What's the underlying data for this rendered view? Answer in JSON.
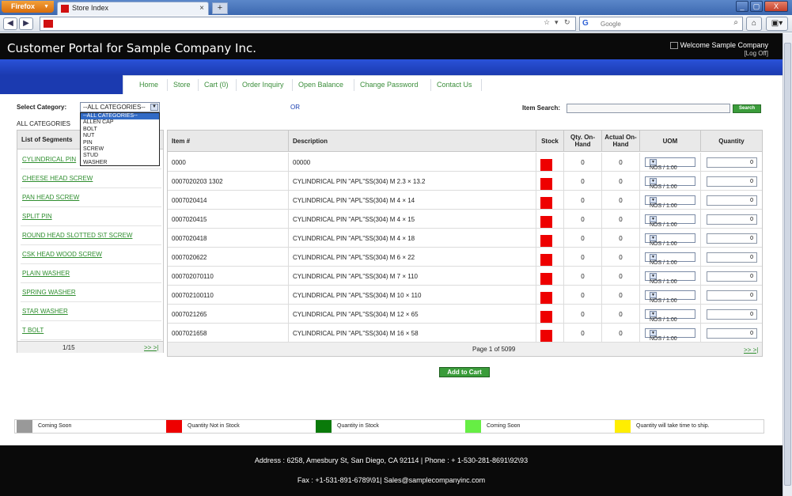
{
  "browser": {
    "menu_button": "Firefox",
    "tab_title": "Store Index",
    "search_placeholder": "Google",
    "new_tab": "+",
    "tab_close": "×",
    "minimize": "_",
    "maximize": "▢",
    "close": "X"
  },
  "header": {
    "title": "Customer Portal  for Sample Company Inc.",
    "welcome_label": "Welcome",
    "company": "Sample Company",
    "logoff": "[Log Off]"
  },
  "menu": [
    "Home",
    "Store",
    "Cart (0)",
    "Order Inquiry",
    "Open Balance",
    "Change Password",
    "Contact Us"
  ],
  "filters": {
    "select_category_label": "Select Category:",
    "selected_category": "--ALL CATEGORIES--",
    "or_text": "OR",
    "item_search_label": "Item Search:",
    "search_button": "Search",
    "all_categories_text": "ALL CATEGORIES"
  },
  "category_options": [
    "--ALL CATEGORIES--",
    "ALLEN CAP",
    "BOLT",
    "NUT",
    "PIN",
    "SCREW",
    "STUD",
    "WASHER"
  ],
  "segments": {
    "header": "List of Segments",
    "items": [
      "CYLINDRICAL PIN",
      "CHEESE HEAD SCREW",
      "PAN HEAD SCREW",
      "SPLIT PIN",
      "ROUND HEAD SLOTTED S\\T SCREW",
      "CSK HEAD WOOD SCREW",
      "PLAIN WASHER",
      "SPRING WASHER",
      "STAR WASHER",
      "T BOLT"
    ],
    "page": "1/15",
    "nav": ">> >|"
  },
  "table": {
    "columns": [
      "Item #",
      "Description",
      "Stock",
      "Qty. On-Hand",
      "Actual On-Hand",
      "UOM",
      "Quantity"
    ],
    "rows": [
      {
        "item": "0000",
        "desc": "00000",
        "stock_color": "#ee0000",
        "qty": "0",
        "actual": "0",
        "uom": "NOS / 1.00",
        "quantity": "0"
      },
      {
        "item": "0007020203 1302",
        "desc": "CYLINDRICAL PIN \"APL\"SS(304) M 2.3 × 13.2",
        "stock_color": "#ee0000",
        "qty": "0",
        "actual": "0",
        "uom": "NOS / 1.00",
        "quantity": "0"
      },
      {
        "item": "0007020414",
        "desc": "CYLINDRICAL PIN \"APL\"SS(304) M 4 × 14",
        "stock_color": "#ee0000",
        "qty": "0",
        "actual": "0",
        "uom": "NOS / 1.00",
        "quantity": "0"
      },
      {
        "item": "0007020415",
        "desc": "CYLINDRICAL PIN \"APL\"SS(304) M 4 × 15",
        "stock_color": "#ee0000",
        "qty": "0",
        "actual": "0",
        "uom": "NOS / 1.00",
        "quantity": "0"
      },
      {
        "item": "0007020418",
        "desc": "CYLINDRICAL PIN \"APL\"SS(304) M 4 × 18",
        "stock_color": "#ee0000",
        "qty": "0",
        "actual": "0",
        "uom": "NOS / 1.00",
        "quantity": "0"
      },
      {
        "item": "0007020622",
        "desc": "CYLINDRICAL PIN \"APL\"SS(304) M 6 × 22",
        "stock_color": "#ee0000",
        "qty": "0",
        "actual": "0",
        "uom": "NOS / 1.00",
        "quantity": "0"
      },
      {
        "item": "000702070110",
        "desc": "CYLINDRICAL PIN \"APL\"SS(304) M 7 × 110",
        "stock_color": "#ee0000",
        "qty": "0",
        "actual": "0",
        "uom": "NOS / 1.00",
        "quantity": "0"
      },
      {
        "item": "000702100110",
        "desc": "CYLINDRICAL PIN \"APL\"SS(304) M 10 × 110",
        "stock_color": "#ee0000",
        "qty": "0",
        "actual": "0",
        "uom": "NOS / 1.00",
        "quantity": "0"
      },
      {
        "item": "0007021265",
        "desc": "CYLINDRICAL PIN \"APL\"SS(304) M 12 × 65",
        "stock_color": "#ee0000",
        "qty": "0",
        "actual": "0",
        "uom": "NOS / 1.00",
        "quantity": "0"
      },
      {
        "item": "0007021658",
        "desc": "CYLINDRICAL PIN \"APL\"SS(304) M 16 × 58",
        "stock_color": "#ee0000",
        "qty": "0",
        "actual": "0",
        "uom": "NOS / 1.00",
        "quantity": "0"
      }
    ],
    "page_text": "Page 1 of 5099",
    "nav": ">> >|"
  },
  "add_to_cart": "Add to Cart",
  "legend": [
    {
      "color": "#999999",
      "text": "Coming Soon"
    },
    {
      "color": "#ee0000",
      "text": "Quantity  Not in Stock"
    },
    {
      "color": "#0a7a0a",
      "text": "Quantity in Stock"
    },
    {
      "color": "#66ee44",
      "text": "Coming Soon"
    },
    {
      "color": "#ffee00",
      "text": "Quantity will take time to ship."
    }
  ],
  "footer": {
    "address": "Address : 6258, Amesbury St, San Diego, CA 92114 | Phone : + 1-530-281-8691\\92\\93",
    "contact": "Fax :  +1-531-891-6789\\91| Sales@samplecompanyinc.com"
  }
}
